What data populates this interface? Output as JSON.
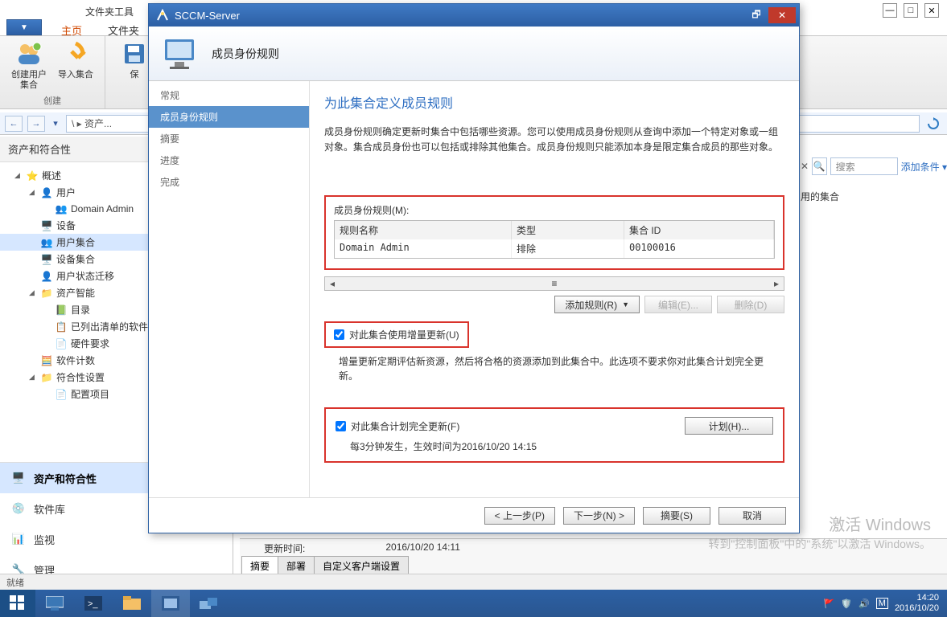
{
  "toolbar": {
    "group_label": "文件夹工具"
  },
  "app_button": "▼",
  "ribbon": {
    "tabs": {
      "home": "主页",
      "folder": "文件夹"
    },
    "buttons": {
      "create_user_collection": "创建用户集合",
      "import_collection": "导入集合",
      "save": "保"
    },
    "groups": {
      "create": "创建"
    }
  },
  "nav": {
    "path": "\\  ▸ 资产..."
  },
  "left": {
    "header": "资产和符合性",
    "tree": {
      "overview": "概述",
      "users": "用户",
      "domain_admin": "Domain Admin",
      "devices": "设备",
      "user_collections": "用户集合",
      "device_collections": "设备集合",
      "user_state_migration": "用户状态迁移",
      "asset_intel": "资产智能",
      "catalog": "目录",
      "inventoried": "已列出清单的软件",
      "hw_req": "硬件要求",
      "sw_metering": "软件计数",
      "compliance": "符合性设置",
      "config_items": "配置项目"
    },
    "wunderbar": {
      "assets": "资产和符合性",
      "software": "软件库",
      "monitoring": "监视",
      "admin": "管理"
    }
  },
  "search": {
    "placeholder": "搜索",
    "add_condition": "添加条件 ▾"
  },
  "columns": {
    "limited_collection": "用的集合"
  },
  "detail": {
    "update_label": "更新时间:",
    "update_value": "2016/10/20 14:11",
    "tabs": {
      "summary": "摘要",
      "deploy": "部署",
      "custom": "自定义客户端设置"
    }
  },
  "status": "就绪",
  "dialog": {
    "title": "SCCM-Server",
    "banner_title": "成员身份规则",
    "nav": {
      "general": "常规",
      "rules": "成员身份规则",
      "summary": "摘要",
      "progress": "进度",
      "complete": "完成"
    },
    "main_title": "为此集合定义成员规则",
    "description": "成员身份规则确定更新时集合中包括哪些资源。您可以使用成员身份规则从查询中添加一个特定对象或一组对象。集合成员身份也可以包括或排除其他集合。成员身份规则只能添加本身是限定集合成员的那些对象。",
    "rules_label": "成员身份规则(M):",
    "table": {
      "headers": {
        "name": "规则名称",
        "type": "类型",
        "id": "集合 ID"
      },
      "row": {
        "name": "Domain Admin",
        "type": "排除",
        "id": "00100016"
      }
    },
    "buttons": {
      "add_rule": "添加规则(R)",
      "edit": "编辑(E)...",
      "delete": "删除(D)"
    },
    "incremental": {
      "checkbox": "对此集合使用增量更新(U)",
      "desc": "增量更新定期评估新资源，然后将合格的资源添加到此集合中。此选项不要求你对此集合计划完全更新。"
    },
    "plan": {
      "checkbox": "对此集合计划完全更新(F)",
      "text": "每3分钟发生，生效时间为2016/10/20 14:15",
      "button": "计划(H)..."
    },
    "footer": {
      "prev": "< 上一步(P)",
      "next": "下一步(N) >",
      "summary": "摘要(S)",
      "cancel": "取消"
    }
  },
  "watermark": {
    "line1": "激活 Windows",
    "line2": "转到\"控制面板\"中的\"系统\"以激活 Windows。"
  },
  "tray": {
    "time": "14:20",
    "date": "2016/10/20"
  }
}
